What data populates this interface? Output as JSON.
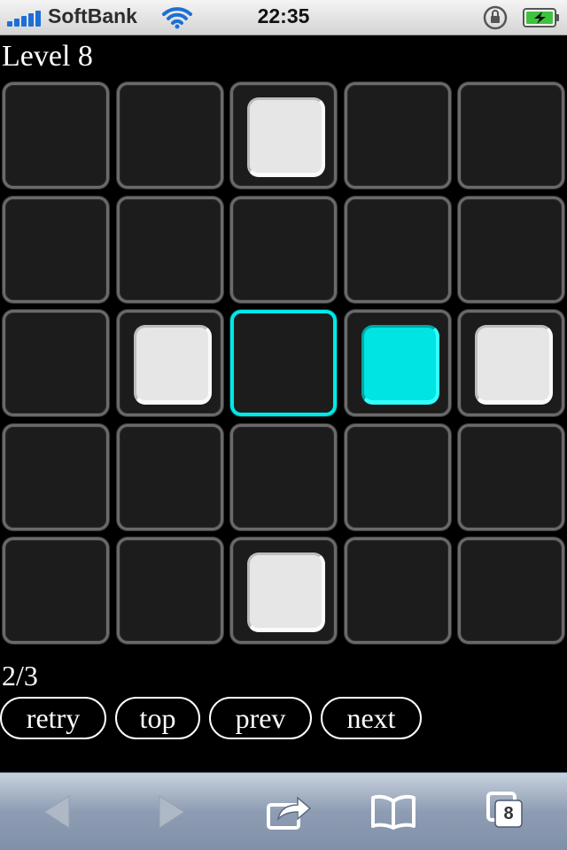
{
  "status_bar": {
    "carrier": "SoftBank",
    "time": "22:35",
    "signal_bars": 5,
    "icons": [
      "signal-icon",
      "wifi-icon",
      "rotation-lock-icon",
      "battery-charging-icon"
    ]
  },
  "game": {
    "level_title": "Level 8",
    "grid": {
      "rows": 5,
      "cols": 5,
      "cells": [
        [
          "empty",
          "empty",
          "white",
          "empty",
          "empty"
        ],
        [
          "empty",
          "empty",
          "empty",
          "empty",
          "empty"
        ],
        [
          "empty",
          "white",
          "target",
          "cyan",
          "white"
        ],
        [
          "empty",
          "empty",
          "empty",
          "empty",
          "empty"
        ],
        [
          "empty",
          "empty",
          "white",
          "empty",
          "empty"
        ]
      ]
    },
    "progress": "2/3",
    "buttons": {
      "retry": "retry",
      "top": "top",
      "prev": "prev",
      "next": "next"
    },
    "colors": {
      "block_white": "#e6e6e6",
      "block_cyan": "#00e4e4",
      "target_border": "#00e8e8",
      "cell_border": "#6a6a6a"
    }
  },
  "toolbar": {
    "icons": [
      "back-arrow-icon",
      "forward-arrow-icon",
      "share-icon",
      "bookmarks-icon",
      "tabs-icon"
    ],
    "tab_count": "8"
  }
}
